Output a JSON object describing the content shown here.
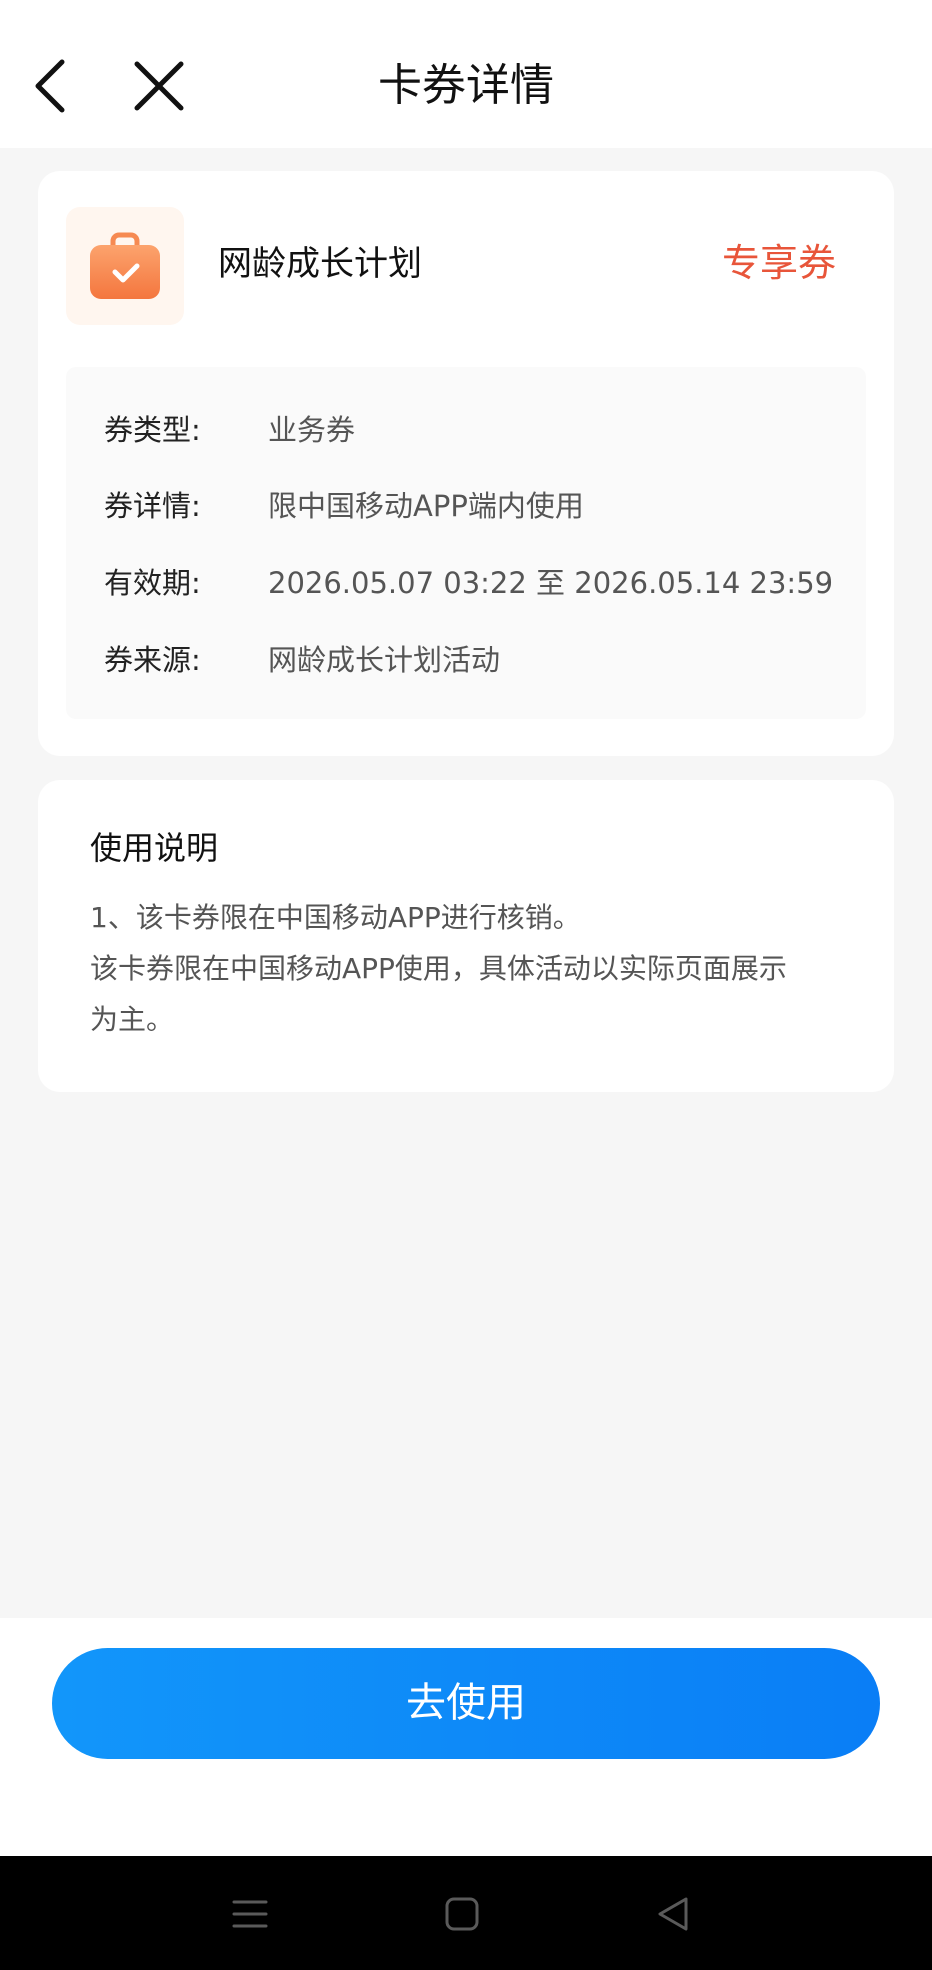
{
  "header": {
    "title": "卡券详情",
    "back_icon": "chevron-left-icon",
    "close_icon": "close-icon"
  },
  "coupon": {
    "name": "网龄成长计划",
    "tag": "专享券",
    "icon": "shopping-bag-check-icon",
    "details": [
      {
        "label": "券类型:",
        "value": "业务券"
      },
      {
        "label": "券详情:",
        "value": "限中国移动APP端内使用"
      },
      {
        "label": "有效期:",
        "value": "2026.05.07 03:22 至 2026.05.14 23:59"
      },
      {
        "label": "券来源:",
        "value": "网龄成长计划活动"
      }
    ]
  },
  "usage": {
    "title": "使用说明",
    "lines": [
      "1、该卡券限在中国移动APP进行核销。",
      "该卡券限在中国移动APP使用，具体活动以实际页面展示",
      "为主。"
    ]
  },
  "action": {
    "use_label": "去使用"
  },
  "colors": {
    "accent_blue": "#0a7ef6",
    "tag_red": "#e8553a",
    "icon_orange": "#f7834a"
  },
  "system_nav": {
    "icons": [
      "menu-icon",
      "home-icon",
      "back-triangle-icon"
    ]
  }
}
